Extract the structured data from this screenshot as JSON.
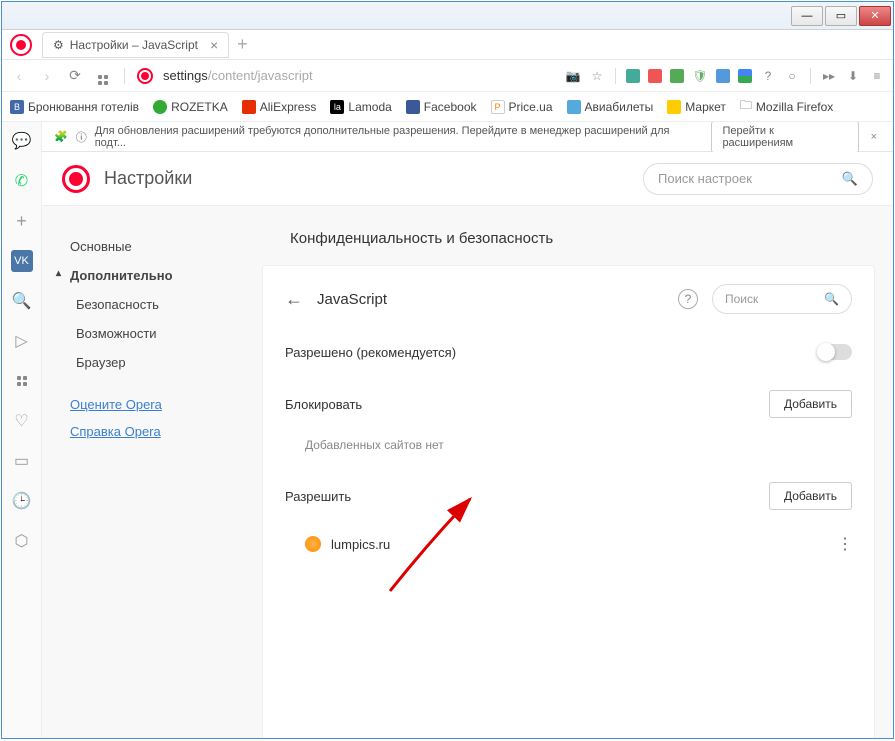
{
  "window": {
    "tab_title": "Настройки – JavaScript"
  },
  "address": {
    "prefix": "settings",
    "path": "/content/javascript"
  },
  "bookmarks": {
    "b0": "Бронювання готелів",
    "b1": "ROZETKA",
    "b2": "AliExpress",
    "b3": "Lamoda",
    "b4": "Facebook",
    "b5": "Price.ua",
    "b6": "Авиабилеты",
    "b7": "Маркет",
    "b8": "Mozilla Firefox"
  },
  "notification": {
    "text": "Для обновления расширений требуются дополнительные разрешения. Перейдите в менеджер расширений для подт...",
    "button": "Перейти к расширениям"
  },
  "header": {
    "title": "Настройки",
    "search_placeholder": "Поиск настроек"
  },
  "nav": {
    "main": "Основные",
    "advanced": "Дополнительно",
    "security": "Безопасность",
    "features": "Возможности",
    "browser": "Браузер",
    "rate": "Оцените Opera",
    "help": "Справка Opera"
  },
  "panel": {
    "section": "Конфиденциальность и безопасность",
    "title": "JavaScript",
    "search_placeholder": "Поиск",
    "allowed_label": "Разрешено (рекомендуется)",
    "block_label": "Блокировать",
    "block_empty": "Добавленных сайтов нет",
    "allow_label": "Разрешить",
    "add_button": "Добавить",
    "site0": "lumpics.ru"
  }
}
